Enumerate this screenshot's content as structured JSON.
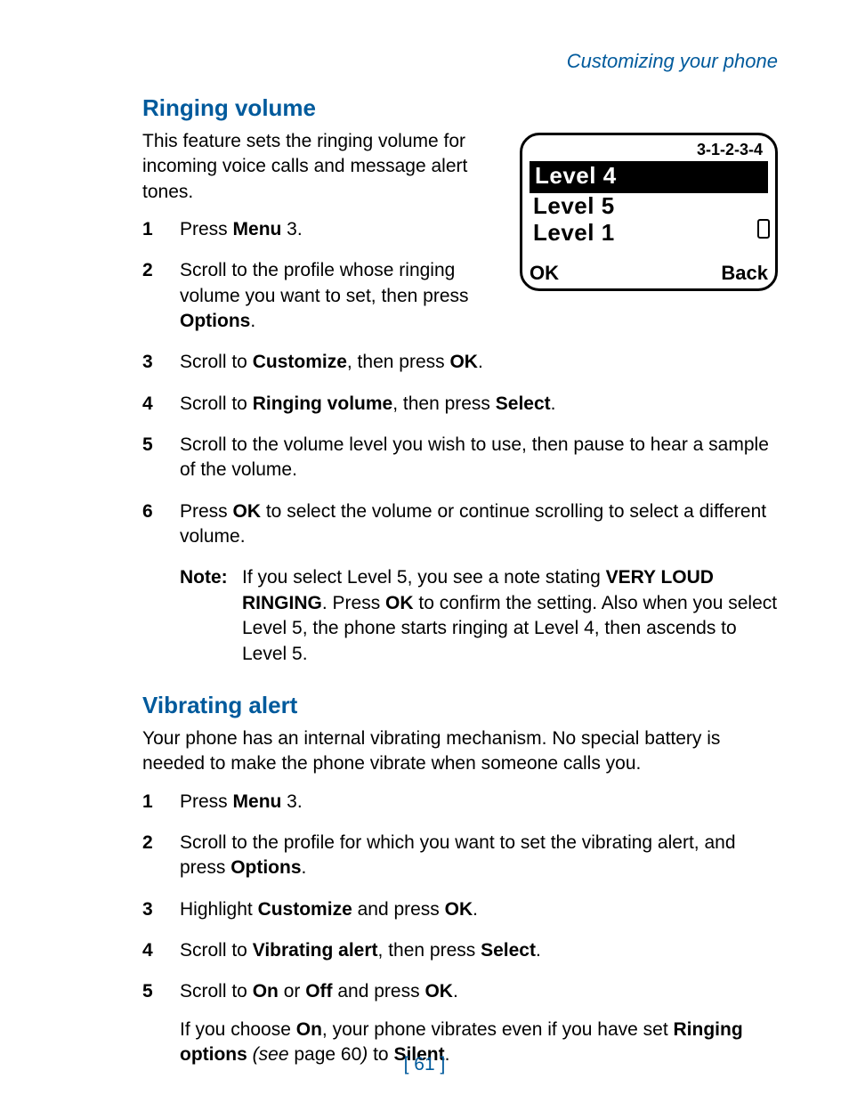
{
  "header": "Customizing your phone",
  "page_number": "[ 61 ]",
  "screen": {
    "code": "3-1-2-3-4",
    "rows": [
      "Level 4",
      "Level 5",
      "Level 1"
    ],
    "soft_left": "OK",
    "soft_right": "Back"
  },
  "section1": {
    "title": "Ringing volume",
    "intro": "This feature sets the ringing volume for incoming voice calls and message alert tones.",
    "steps": {
      "s1a": "Press ",
      "s1b": "Menu",
      "s1c": " 3.",
      "s2a": "Scroll to the profile whose ringing volume you want to set, then press ",
      "s2b": "Options",
      "s2c": ".",
      "s3a": "Scroll to ",
      "s3b": "Customize",
      "s3c": ", then press ",
      "s3d": "OK",
      "s3e": ".",
      "s4a": "Scroll to ",
      "s4b": "Ringing volume",
      "s4c": ", then press ",
      "s4d": "Select",
      "s4e": ".",
      "s5": "Scroll to the volume level you wish to use, then pause to hear a sample of the volume.",
      "s6a": "Press ",
      "s6b": "OK",
      "s6c": " to select the volume or continue scrolling to select a different volume."
    },
    "note": {
      "label": "Note:",
      "a": "If you select Level 5, you see a note stating ",
      "b": "VERY LOUD RINGING",
      "c": ". Press ",
      "d": "OK",
      "e": " to confirm the setting. Also when you select Level 5, the phone starts ringing at Level 4, then ascends to Level 5."
    }
  },
  "section2": {
    "title": "Vibrating alert",
    "intro": "Your phone has an internal vibrating mechanism. No special battery is needed to make the phone vibrate when someone calls you.",
    "steps": {
      "s1a": "Press ",
      "s1b": "Menu",
      "s1c": " 3.",
      "s2a": "Scroll to the profile for which you want to set the vibrating alert, and press ",
      "s2b": "Options",
      "s2c": ".",
      "s3a": "Highlight ",
      "s3b": "Customize",
      "s3c": " and press ",
      "s3d": "OK",
      "s3e": ".",
      "s4a": "Scroll to ",
      "s4b": "Vibrating alert",
      "s4c": ", then press ",
      "s4d": "Select",
      "s4e": ".",
      "s5a": "Scroll to ",
      "s5b": "On",
      "s5c": " or ",
      "s5d": "Off",
      "s5e": " and press ",
      "s5f": "OK",
      "s5g": "."
    },
    "followup": {
      "a": "If you choose ",
      "b": "On",
      "c": ", your phone vibrates even if you have set ",
      "d": "Ringing options",
      "e": " (see",
      "f": " page 60",
      "g": ")",
      "h": " to ",
      "i": "Silent",
      "j": "."
    }
  }
}
